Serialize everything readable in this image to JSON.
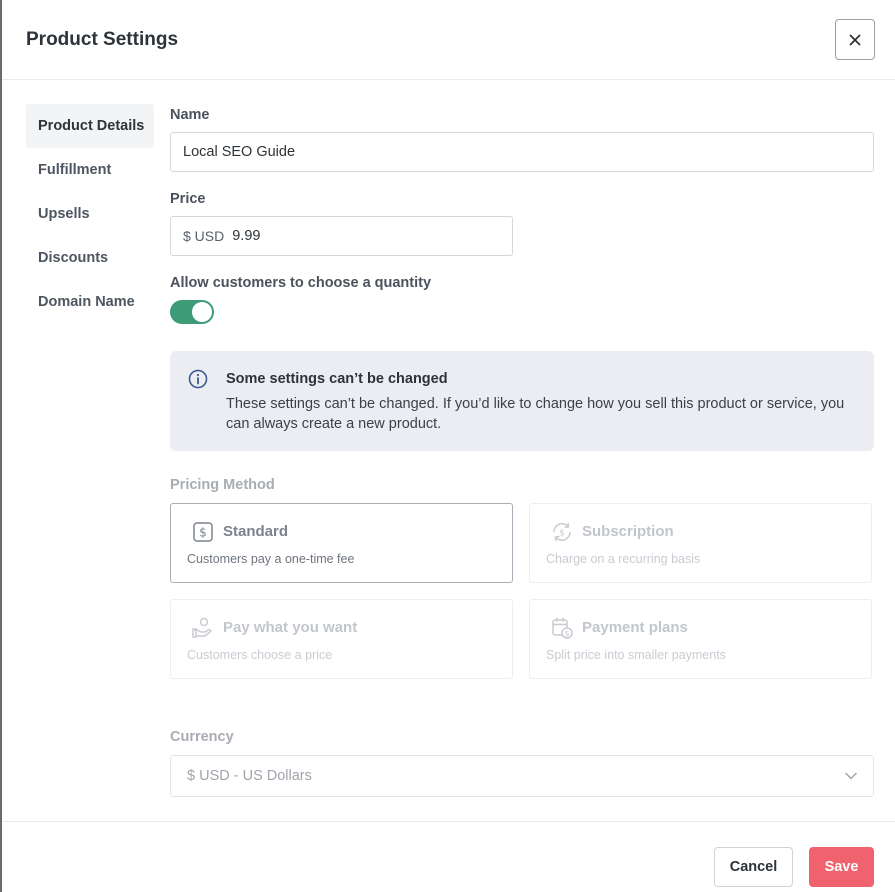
{
  "dialog": {
    "title": "Product Settings",
    "close_icon": "close-icon"
  },
  "sidebar": {
    "items": [
      {
        "label": "Product Details",
        "active": true
      },
      {
        "label": "Fulfillment",
        "active": false
      },
      {
        "label": "Upsells",
        "active": false
      },
      {
        "label": "Discounts",
        "active": false
      },
      {
        "label": "Domain Name",
        "active": false
      }
    ]
  },
  "form": {
    "name_label": "Name",
    "name_value": "Local SEO Guide",
    "price_label": "Price",
    "price_prefix": "$ USD",
    "price_value": "9.99",
    "quantity_label": "Allow customers to choose a quantity",
    "quantity_enabled": true
  },
  "notice": {
    "icon": "info-icon",
    "title": "Some settings can’t be changed",
    "body": "These settings can’t be changed. If you’d like to change how you sell this product or service, you can always create a new product."
  },
  "pricing": {
    "label": "Pricing Method",
    "options": [
      {
        "title": "Standard",
        "desc": "Customers pay a one-time fee",
        "icon": "dollar-icon",
        "selected": true
      },
      {
        "title": "Subscription",
        "desc": "Charge on a recurring basis",
        "icon": "recurring-icon",
        "selected": false
      },
      {
        "title": "Pay what you want",
        "desc": "Customers choose a price",
        "icon": "hand-coin-icon",
        "selected": false
      },
      {
        "title": "Payment plans",
        "desc": "Split price into smaller payments",
        "icon": "calendar-dollar-icon",
        "selected": false
      }
    ]
  },
  "currency": {
    "label": "Currency",
    "value": "$ USD - US Dollars"
  },
  "footer": {
    "cancel_label": "Cancel",
    "save_label": "Save"
  },
  "colors": {
    "accent_green": "#3d9b77",
    "save_red": "#f0636e"
  }
}
